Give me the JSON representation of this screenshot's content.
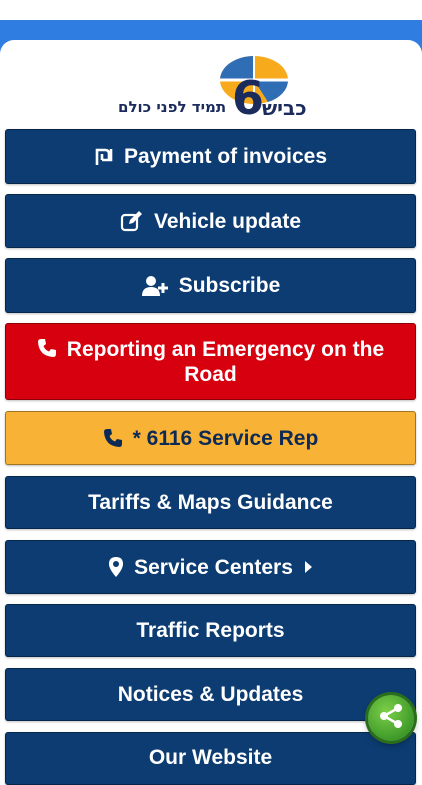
{
  "logo": {
    "tagline": "תמיד לפני כולם",
    "word": "כביש",
    "numeral": "6"
  },
  "menu": {
    "items": [
      {
        "label": "Payment of invoices",
        "icon": "shekel-icon",
        "style": "blue"
      },
      {
        "label": "Vehicle update",
        "icon": "edit-icon",
        "style": "blue"
      },
      {
        "label": "Subscribe",
        "icon": "user-plus-icon",
        "style": "blue"
      },
      {
        "label": "Reporting an Emergency on the Road",
        "icon": "phone-icon",
        "style": "red"
      },
      {
        "label": "* 6116 Service Rep",
        "icon": "phone-icon",
        "style": "yellow"
      },
      {
        "label": "Tariffs & Maps Guidance",
        "icon": "",
        "style": "blue"
      },
      {
        "label": "Service Centers",
        "icon": "map-marker-icon",
        "trailing_icon": "caret-right-icon",
        "style": "blue"
      },
      {
        "label": "Traffic Reports",
        "icon": "",
        "style": "blue"
      },
      {
        "label": "Notices & Updates",
        "icon": "",
        "style": "blue"
      },
      {
        "label": "Our Website",
        "icon": "",
        "style": "blue"
      }
    ]
  },
  "share": {
    "icon": "share-icon"
  },
  "colors": {
    "header_blue": "#2f7de1",
    "button_blue": "#0c3c72",
    "emergency_red": "#d6000f",
    "service_yellow": "#f8b337",
    "share_green": "#4caf32"
  }
}
